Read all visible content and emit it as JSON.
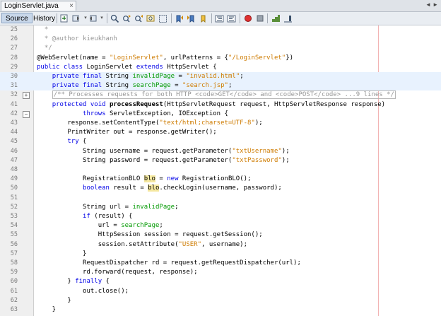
{
  "file_tab": {
    "label": "LoginServlet.java",
    "close": "×"
  },
  "tab_scroll": "◄ ►",
  "toolbar": {
    "source_label": "Source",
    "history_label": "History"
  },
  "editor": {
    "lines": [
      {
        "num": "25",
        "tokens": [
          {
            "t": "  *",
            "c": "com"
          }
        ]
      },
      {
        "num": "26",
        "tokens": [
          {
            "t": "  * @author kieukhanh",
            "c": "com"
          }
        ]
      },
      {
        "num": "27",
        "tokens": [
          {
            "t": "  */",
            "c": "com"
          }
        ]
      },
      {
        "num": "28",
        "tokens": [
          {
            "t": "@WebServlet(name = "
          },
          {
            "t": "\"LoginServlet\"",
            "c": "str"
          },
          {
            "t": ", urlPatterns = {"
          },
          {
            "t": "\"/LoginServlet\"",
            "c": "str"
          },
          {
            "t": "})"
          }
        ]
      },
      {
        "num": "29",
        "tokens": [
          {
            "t": "public class",
            "c": "kw"
          },
          {
            "t": " LoginServlet "
          },
          {
            "t": "extends",
            "c": "kw"
          },
          {
            "t": " HttpServlet {"
          }
        ]
      },
      {
        "num": "30",
        "hl": true,
        "tokens": [
          {
            "t": "    "
          },
          {
            "t": "private final",
            "c": "kw"
          },
          {
            "t": " String "
          },
          {
            "t": "invalidPage",
            "c": "fld"
          },
          {
            "t": " = "
          },
          {
            "t": "\"invalid.html\"",
            "c": "str"
          },
          {
            "t": ";"
          }
        ]
      },
      {
        "num": "31",
        "hl": true,
        "tokens": [
          {
            "t": "    "
          },
          {
            "t": "private final",
            "c": "kw"
          },
          {
            "t": " String "
          },
          {
            "t": "searchPage",
            "c": "fld"
          },
          {
            "t": " = "
          },
          {
            "t": "\"search.jsp\"",
            "c": "str"
          },
          {
            "t": ";"
          }
        ]
      },
      {
        "num": "32",
        "fold": "+",
        "tokens": [
          {
            "t": "    "
          },
          {
            "t": "/** Processes requests for both HTTP <code>GET</code> and <code>POST</code> ...9 lines */",
            "c": "foldcom"
          }
        ]
      },
      {
        "num": "41",
        "tokens": [
          {
            "t": "    "
          },
          {
            "t": "protected void",
            "c": "kw"
          },
          {
            "t": " "
          },
          {
            "t": "processRequest",
            "c": "meth"
          },
          {
            "t": "(HttpServletRequest request, HttpServletResponse response)"
          }
        ]
      },
      {
        "num": "42",
        "fold": "−",
        "tokens": [
          {
            "t": "            "
          },
          {
            "t": "throws",
            "c": "kw"
          },
          {
            "t": " ServletException, IOException {"
          }
        ]
      },
      {
        "num": "43",
        "tokens": [
          {
            "t": "        response.setContentType("
          },
          {
            "t": "\"text/html;charset=UTF-8\"",
            "c": "str"
          },
          {
            "t": ");"
          }
        ]
      },
      {
        "num": "44",
        "tokens": [
          {
            "t": "        PrintWriter out = response.getWriter();"
          }
        ]
      },
      {
        "num": "45",
        "tokens": [
          {
            "t": "        "
          },
          {
            "t": "try",
            "c": "kw"
          },
          {
            "t": " {"
          }
        ]
      },
      {
        "num": "46",
        "tokens": [
          {
            "t": "            String username = request.getParameter("
          },
          {
            "t": "\"txtUsername\"",
            "c": "str"
          },
          {
            "t": ");"
          }
        ]
      },
      {
        "num": "47",
        "tokens": [
          {
            "t": "            String password = request.getParameter("
          },
          {
            "t": "\"txtPassword\"",
            "c": "str"
          },
          {
            "t": ");"
          }
        ]
      },
      {
        "num": "48",
        "tokens": []
      },
      {
        "num": "49",
        "tokens": [
          {
            "t": "            RegistrationBLO "
          },
          {
            "t": "blo",
            "c": "occ"
          },
          {
            "t": " = "
          },
          {
            "t": "new",
            "c": "kw"
          },
          {
            "t": " RegistrationBLO();"
          }
        ]
      },
      {
        "num": "50",
        "tokens": [
          {
            "t": "            "
          },
          {
            "t": "boolean",
            "c": "kw"
          },
          {
            "t": " result = "
          },
          {
            "t": "blo",
            "c": "occ"
          },
          {
            "t": ".checkLogin(username, password);"
          }
        ]
      },
      {
        "num": "51",
        "tokens": []
      },
      {
        "num": "52",
        "tokens": [
          {
            "t": "            String url = "
          },
          {
            "t": "invalidPage",
            "c": "fld"
          },
          {
            "t": ";"
          }
        ]
      },
      {
        "num": "53",
        "tokens": [
          {
            "t": "            "
          },
          {
            "t": "if",
            "c": "kw"
          },
          {
            "t": " (result) {"
          }
        ]
      },
      {
        "num": "54",
        "tokens": [
          {
            "t": "                url = "
          },
          {
            "t": "searchPage",
            "c": "fld"
          },
          {
            "t": ";"
          }
        ]
      },
      {
        "num": "55",
        "tokens": [
          {
            "t": "                HttpSession session = request.getSession();"
          }
        ]
      },
      {
        "num": "56",
        "tokens": [
          {
            "t": "                session.setAttribute("
          },
          {
            "t": "\"USER\"",
            "c": "str"
          },
          {
            "t": ", username);"
          }
        ]
      },
      {
        "num": "57",
        "tokens": [
          {
            "t": "            }"
          }
        ]
      },
      {
        "num": "58",
        "tokens": [
          {
            "t": "            RequestDispatcher rd = request.getRequestDispatcher(url);"
          }
        ]
      },
      {
        "num": "59",
        "tokens": [
          {
            "t": "            rd.forward(request, response);"
          }
        ]
      },
      {
        "num": "60",
        "tokens": [
          {
            "t": "        } "
          },
          {
            "t": "finally",
            "c": "kw"
          },
          {
            "t": " {"
          }
        ]
      },
      {
        "num": "61",
        "tokens": [
          {
            "t": "            out.close();"
          }
        ]
      },
      {
        "num": "62",
        "tokens": [
          {
            "t": "        }"
          }
        ]
      },
      {
        "num": "63",
        "tokens": [
          {
            "t": "    }"
          }
        ]
      }
    ]
  }
}
